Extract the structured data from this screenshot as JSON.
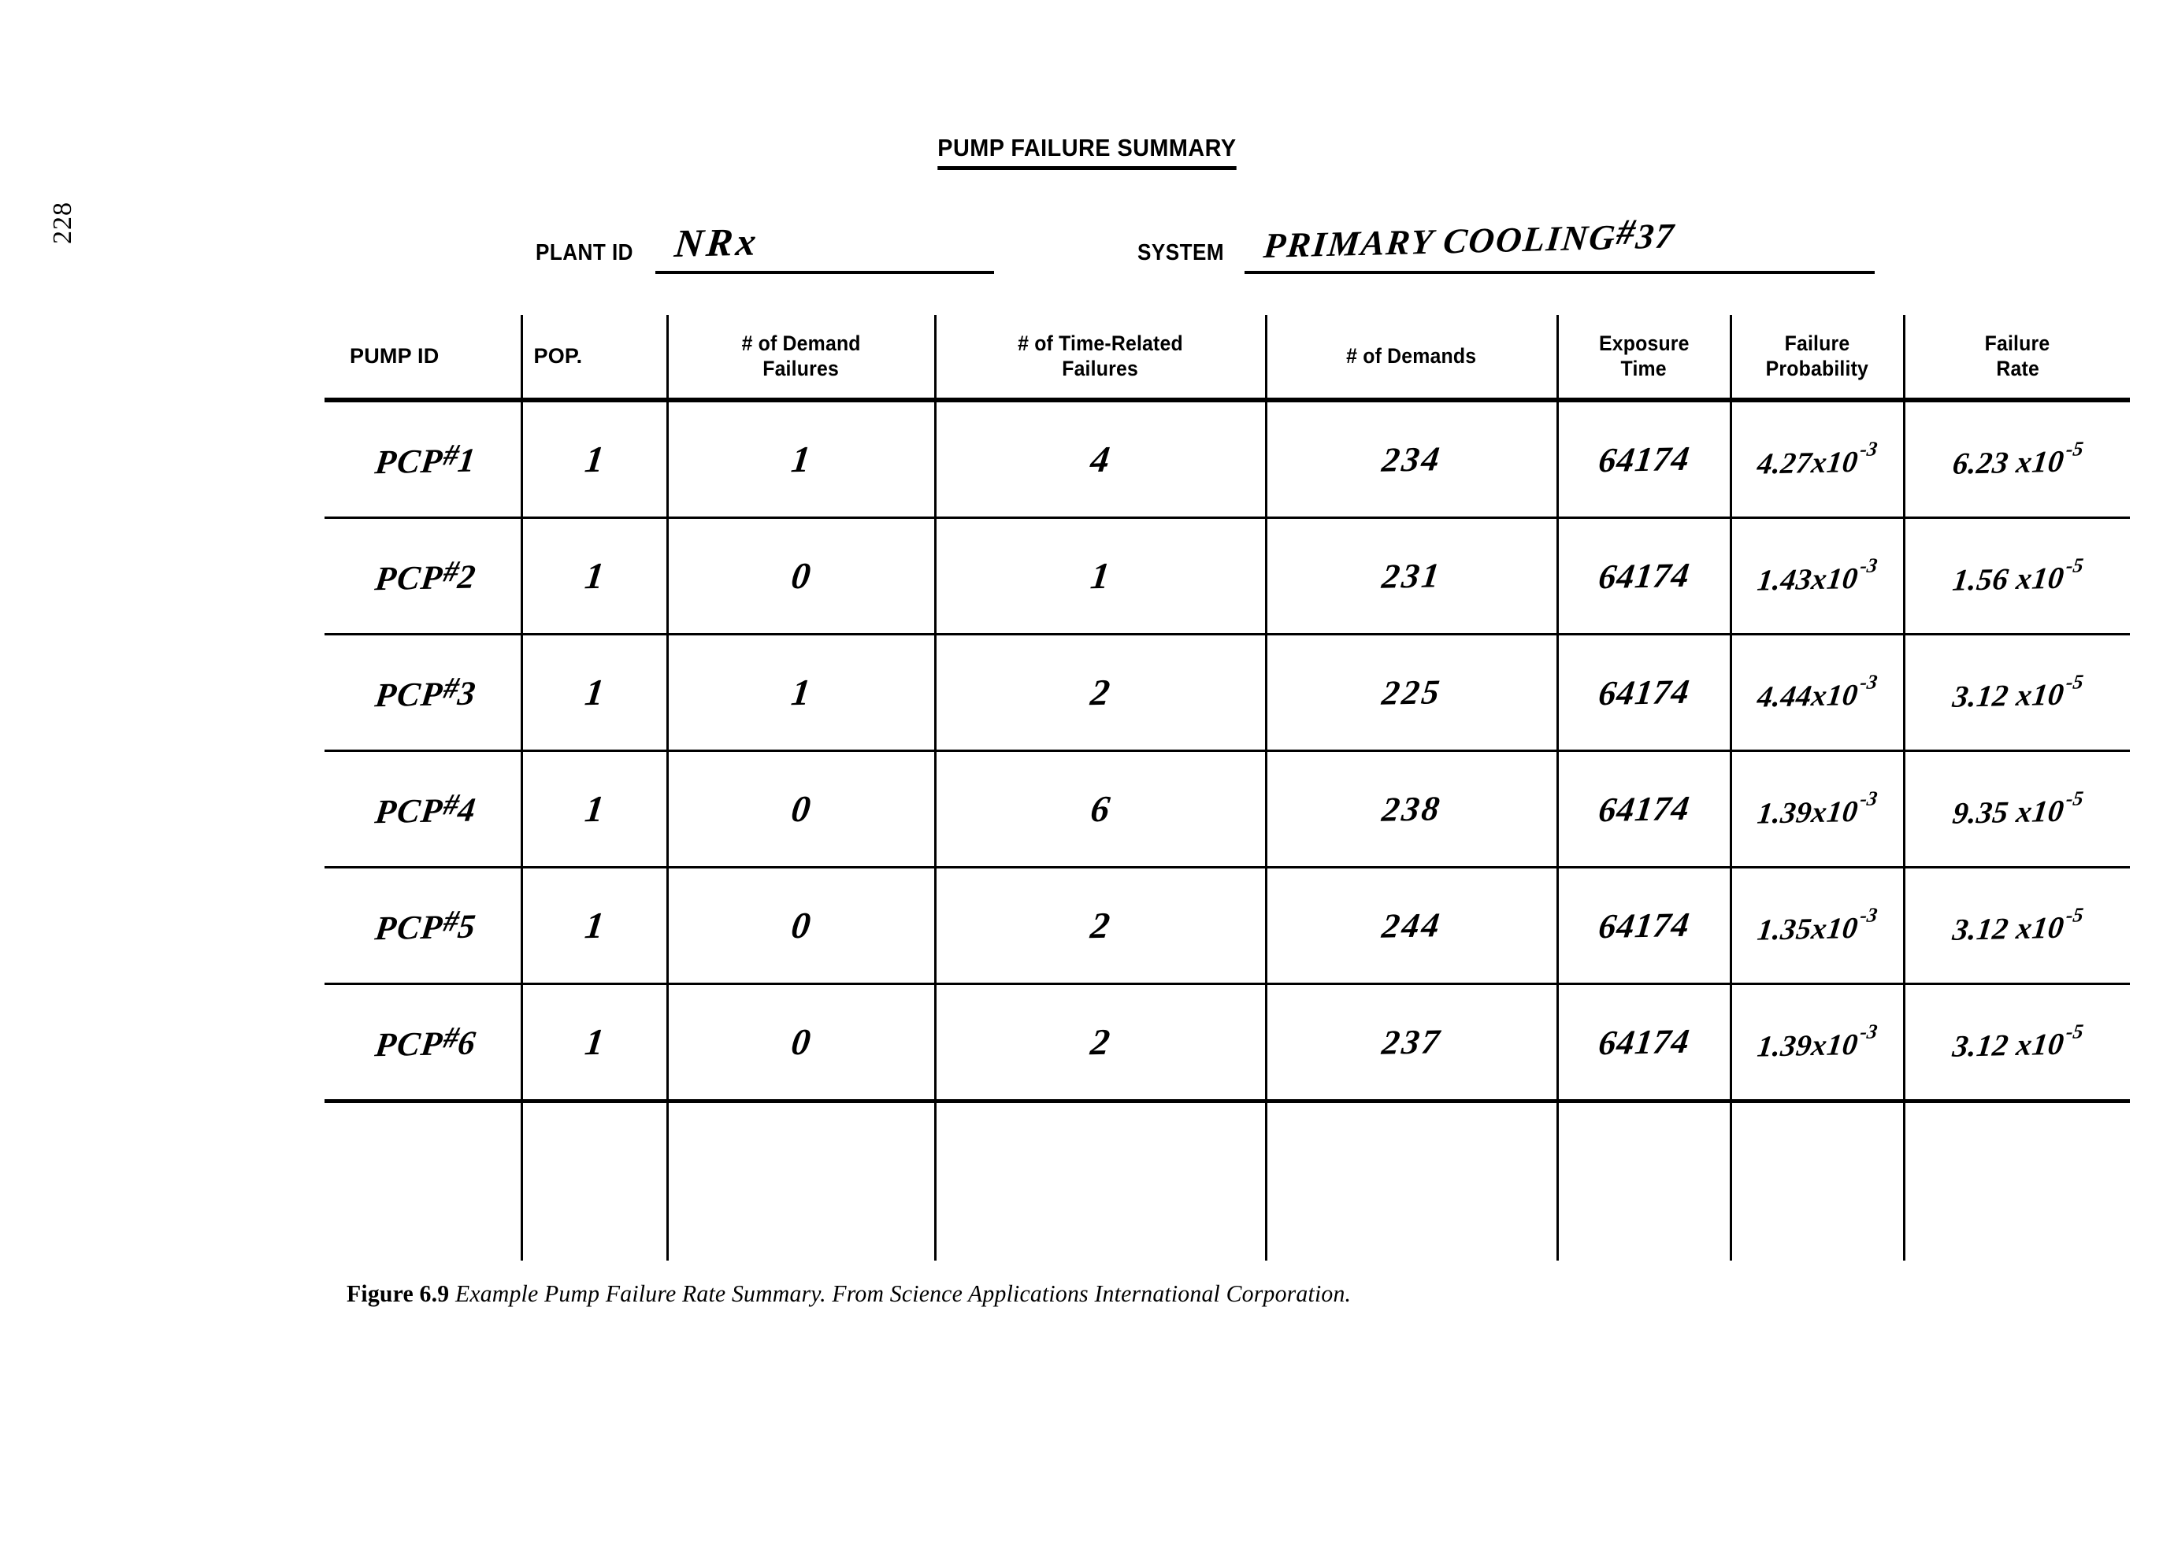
{
  "page": {
    "page_number": "228"
  },
  "form": {
    "title": "PUMP FAILURE SUMMARY",
    "fields": {
      "plant_id_label": "PLANT ID",
      "plant_id_value": "NRx",
      "system_label": "SYSTEM",
      "system_value": "PRIMARY COOLING",
      "system_value_suffix_hash": "#",
      "system_value_suffix_number": "37"
    }
  },
  "table": {
    "headers": [
      "PUMP ID",
      "POP.",
      "# of Demand Failures",
      "# of Time-Related Failures",
      "# of Demands",
      "Exposure Time",
      "Failure Probability",
      "Failure Rate"
    ],
    "header_lines": {
      "pump_id": "PUMP ID",
      "pop": "POP.",
      "demand_failures_1": "# of Demand",
      "demand_failures_2": "Failures",
      "time_related_1": "# of Time-Related",
      "time_related_2": "Failures",
      "demands": "# of Demands",
      "exposure_1": "Exposure",
      "exposure_2": "Time",
      "fail_prob_1": "Failure",
      "fail_prob_2": "Probability",
      "fail_rate_1": "Failure",
      "fail_rate_2": "Rate"
    },
    "rows": [
      {
        "pump_prefix": "PCP",
        "pump_hash": "#",
        "pump_num": "1",
        "pop": "1",
        "demand_failures": "1",
        "time_related_failures": "4",
        "demands": "234",
        "exposure_time": "64174",
        "failure_probability_mantissa": "4.27x10",
        "failure_probability_exponent": "-3",
        "failure_rate_mantissa": "6.23 x10",
        "failure_rate_exponent": "-5"
      },
      {
        "pump_prefix": "PCP",
        "pump_hash": "#",
        "pump_num": "2",
        "pop": "1",
        "demand_failures": "0",
        "time_related_failures": "1",
        "demands": "231",
        "exposure_time": "64174",
        "failure_probability_mantissa": "1.43x10",
        "failure_probability_exponent": "-3",
        "failure_rate_mantissa": "1.56 x10",
        "failure_rate_exponent": "-5"
      },
      {
        "pump_prefix": "PCP",
        "pump_hash": "#",
        "pump_num": "3",
        "pop": "1",
        "demand_failures": "1",
        "time_related_failures": "2",
        "demands": "225",
        "exposure_time": "64174",
        "failure_probability_mantissa": "4.44x10",
        "failure_probability_exponent": "-3",
        "failure_rate_mantissa": "3.12 x10",
        "failure_rate_exponent": "-5"
      },
      {
        "pump_prefix": "PCP",
        "pump_hash": "#",
        "pump_num": "4",
        "pop": "1",
        "demand_failures": "0",
        "time_related_failures": "6",
        "demands": "238",
        "exposure_time": "64174",
        "failure_probability_mantissa": "1.39x10",
        "failure_probability_exponent": "-3",
        "failure_rate_mantissa": "9.35 x10",
        "failure_rate_exponent": "-5"
      },
      {
        "pump_prefix": "PCP",
        "pump_hash": "#",
        "pump_num": "5",
        "pop": "1",
        "demand_failures": "0",
        "time_related_failures": "2",
        "demands": "244",
        "exposure_time": "64174",
        "failure_probability_mantissa": "1.35x10",
        "failure_probability_exponent": "-3",
        "failure_rate_mantissa": "3.12 x10",
        "failure_rate_exponent": "-5"
      },
      {
        "pump_prefix": "PCP",
        "pump_hash": "#",
        "pump_num": "6",
        "pop": "1",
        "demand_failures": "0",
        "time_related_failures": "2",
        "demands": "237",
        "exposure_time": "64174",
        "failure_probability_mantissa": "1.39x10",
        "failure_probability_exponent": "-3",
        "failure_rate_mantissa": "3.12 x10",
        "failure_rate_exponent": "-5"
      }
    ]
  },
  "caption": {
    "figure_label": "Figure 6.9",
    "figure_text": "Example Pump Failure Rate Summary. From Science Applications International Corporation."
  },
  "colors": {
    "ink": "#000000",
    "paper": "#ffffff"
  }
}
